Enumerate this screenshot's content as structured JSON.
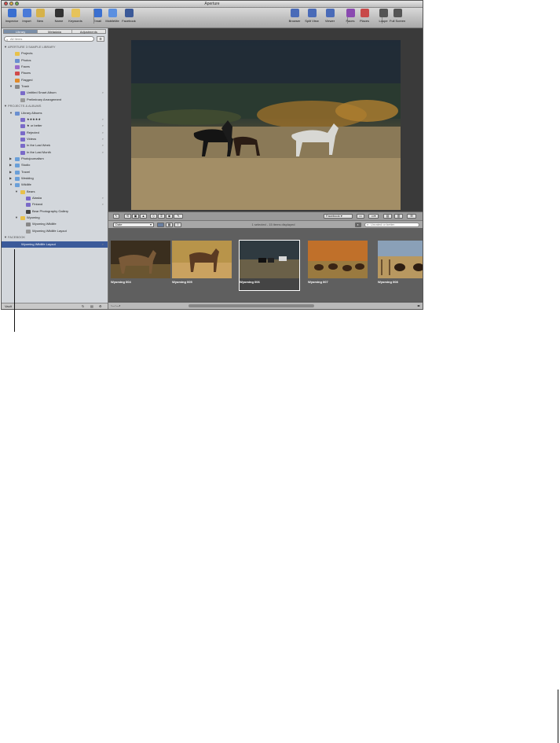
{
  "window": {
    "title": "Aperture"
  },
  "toolbar": {
    "left": [
      {
        "label": "Inspector",
        "icon": "info-icon",
        "color": "#3a6fd0"
      },
      {
        "label": "Import",
        "icon": "import-arrow-icon",
        "color": "#4a7ad8"
      },
      {
        "label": "New",
        "icon": "new-folder-icon",
        "color": "#d6b24a"
      },
      {
        "label": "Name",
        "icon": "name-icon",
        "color": "#333333"
      },
      {
        "label": "Keywords",
        "icon": "keywords-icon",
        "color": "#e6c35a"
      },
      {
        "label": "Email",
        "icon": "email-icon",
        "color": "#3a6fd0"
      },
      {
        "label": "MobileMe",
        "icon": "cloud-icon",
        "color": "#5b8fe0"
      },
      {
        "label": "Facebook",
        "icon": "facebook-icon",
        "color": "#3b5998"
      }
    ],
    "right": [
      {
        "label": "Browser",
        "icon": "browser-grid-icon",
        "color": "#4a6bb8"
      },
      {
        "label": "Split View",
        "icon": "split-view-icon",
        "color": "#4a6bb8"
      },
      {
        "label": "Viewer",
        "icon": "viewer-icon",
        "color": "#4a6bb8"
      },
      {
        "label": "Faces",
        "icon": "faces-icon",
        "color": "#8a4ab0"
      },
      {
        "label": "Places",
        "icon": "places-icon",
        "color": "#c84a4a"
      },
      {
        "label": "Loupe",
        "icon": "loupe-icon",
        "color": "#555555"
      },
      {
        "label": "Full Screen",
        "icon": "full-screen-icon",
        "color": "#555555"
      }
    ]
  },
  "sidebar": {
    "tabs": [
      "Library",
      "Metadata",
      "Adjustments"
    ],
    "search_placeholder": "All Items",
    "tree": [
      {
        "label": "APERTURE 3 SAMPLE LIBRARY",
        "level": 0,
        "header": true,
        "tri": "▼"
      },
      {
        "label": "Projects",
        "level": 1,
        "icon": "#e8c14a"
      },
      {
        "label": "Photos",
        "level": 1,
        "icon": "#6a8fd0"
      },
      {
        "label": "Faces",
        "level": 1,
        "icon": "#9a6ac8"
      },
      {
        "label": "Places",
        "level": 1,
        "icon": "#d04a4a"
      },
      {
        "label": "Flagged",
        "level": 1,
        "icon": "#e08a2a"
      },
      {
        "label": "Trash",
        "level": 1,
        "icon": "#888888",
        "tri": "▼"
      },
      {
        "label": "Untitled Smart Album",
        "level": 2,
        "icon": "#7a6ac8",
        "mag": true
      },
      {
        "label": "Preliminary Arrangement",
        "level": 2,
        "icon": "#999999"
      },
      {
        "label": "PROJECTS & ALBUMS",
        "level": 0,
        "header": true,
        "tri": "▼"
      },
      {
        "label": "Library Albums",
        "level": 1,
        "icon": "#6a8fd0",
        "tri": "▼"
      },
      {
        "label": "★★★★★",
        "level": 2,
        "icon": "#7a6ac8",
        "mag": true
      },
      {
        "label": "★ or better",
        "level": 2,
        "icon": "#7a6ac8",
        "mag": true
      },
      {
        "label": "Rejected",
        "level": 2,
        "icon": "#7a6ac8",
        "mag": true
      },
      {
        "label": "Videos",
        "level": 2,
        "icon": "#7a6ac8",
        "mag": true
      },
      {
        "label": "In the Last Week",
        "level": 2,
        "icon": "#7a6ac8",
        "mag": true
      },
      {
        "label": "In the Last Month",
        "level": 2,
        "icon": "#7a6ac8",
        "mag": true
      },
      {
        "label": "Photojournalism",
        "level": 1,
        "icon": "#6a9fd8",
        "tri": "▶"
      },
      {
        "label": "Studio",
        "level": 1,
        "icon": "#6a9fd8",
        "tri": "▶"
      },
      {
        "label": "Travel",
        "level": 1,
        "icon": "#6a9fd8",
        "tri": "▶"
      },
      {
        "label": "Wedding",
        "level": 1,
        "icon": "#6a9fd8",
        "tri": "▶"
      },
      {
        "label": "Wildlife",
        "level": 1,
        "icon": "#6a9fd8",
        "tri": "▼"
      },
      {
        "label": "Bears",
        "level": 2,
        "icon": "#e8c14a",
        "tri": "▼"
      },
      {
        "label": "Alaska",
        "level": 3,
        "icon": "#7a6ac8",
        "mag": true
      },
      {
        "label": "Finland",
        "level": 3,
        "icon": "#7a6ac8",
        "mag": true
      },
      {
        "label": "Bear Photography Gallery",
        "level": 3,
        "icon": "#444444"
      },
      {
        "label": "Wyoming",
        "level": 2,
        "icon": "#e8c14a",
        "tri": "▼"
      },
      {
        "label": "Wyoming Wildlife",
        "level": 3,
        "icon": "#888888"
      },
      {
        "label": "Wyoming Wildlife Layout",
        "level": 3,
        "icon": "#999999"
      },
      {
        "label": "FACEBOOK",
        "level": 0,
        "header": true,
        "tri": "▼"
      },
      {
        "label": "Wyoming Wildlife Layout",
        "level": 1,
        "icon": "#3b5998",
        "selected": true,
        "mag": true
      }
    ],
    "bottom_label": "Vault"
  },
  "controls": {
    "share_label": "Facebook",
    "sort_label": "Date",
    "status_text": "1 selected - 15 items displayed",
    "filter_placeholder": "Unrated or better"
  },
  "thumbnails": [
    {
      "label": "Wyoming 004",
      "selected": false,
      "scene": "elk-dark"
    },
    {
      "label": "Wyoming 005",
      "selected": false,
      "scene": "elk-field"
    },
    {
      "label": "Wyoming 006",
      "selected": true,
      "scene": "horses"
    },
    {
      "label": "Wyoming 007",
      "selected": false,
      "scene": "bison-autumn"
    },
    {
      "label": "Wyoming 008",
      "selected": false,
      "scene": "bison-fence"
    }
  ]
}
